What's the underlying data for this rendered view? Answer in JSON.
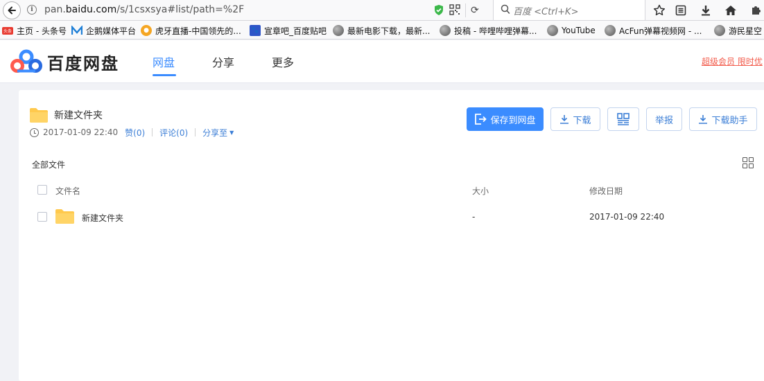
{
  "browser": {
    "url_prefix": "pan.",
    "url_domain": "baidu.com",
    "url_path": "/s/1csxsya#list/path=%2F",
    "search_placeholder": "百度 <Ctrl+K>"
  },
  "bookmarks": [
    {
      "label": "主页 - 头条号",
      "icon": "toutiao-icon",
      "color": "#e83a30"
    },
    {
      "label": "企鹅媒体平台",
      "icon": "penguin-media-icon",
      "color": "#1e7fd6"
    },
    {
      "label": "虎牙直播-中国领先的...",
      "icon": "huya-icon",
      "color": "#f5a623"
    },
    {
      "label": "宣章吧_百度贴吧",
      "icon": "tieba-icon",
      "color": "#2e55c8"
    },
    {
      "label": "最新电影下载，最新...",
      "icon": "globe-icon",
      "color": "#777777"
    },
    {
      "label": "投稿 - 哔哩哔哩弹幕...",
      "icon": "globe-icon",
      "color": "#777777"
    },
    {
      "label": "YouTube",
      "icon": "globe-icon",
      "color": "#777777"
    },
    {
      "label": "AcFun弹幕视频网 - ...",
      "icon": "globe-icon",
      "color": "#777777"
    },
    {
      "label": "游民星空",
      "icon": "globe-icon",
      "color": "#777777"
    }
  ],
  "header": {
    "logo_text": "百度网盘",
    "nav": [
      "网盘",
      "分享",
      "更多"
    ],
    "vip_link": "超级会员 限时优"
  },
  "share": {
    "title": "新建文件夹",
    "datetime": "2017-01-09 22:40",
    "like": "赞(0)",
    "comment": "评论(0)",
    "share_to": "分享至"
  },
  "actions": {
    "save": "保存到网盘",
    "download": "下载",
    "report": "举报",
    "download_helper": "下载助手"
  },
  "breadcrumb": "全部文件",
  "table": {
    "headers": {
      "name": "文件名",
      "size": "大小",
      "modified": "修改日期"
    },
    "rows": [
      {
        "name": "新建文件夹",
        "size": "-",
        "modified": "2017-01-09 22:40"
      }
    ]
  },
  "colors": {
    "accent": "#3b8cff",
    "link": "#3b7ed6",
    "vip": "#f25a4a",
    "folder": "#ffc94d"
  }
}
